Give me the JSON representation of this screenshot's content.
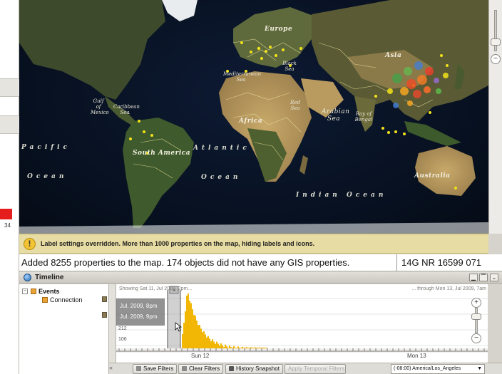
{
  "left_panel": {
    "badge_count": "34",
    "badge_color": "#e61d1d"
  },
  "map": {
    "labels": {
      "europe": "Europe",
      "asia": "Asia",
      "africa": "Africa",
      "south_america": "South America",
      "australia": "Australia",
      "pacific": "Pacific",
      "pacific_ocean": "Ocean",
      "atlantic": "Atlantic",
      "atlantic_ocean": "Ocean",
      "indian_ocean": "Indian Ocean",
      "black_sea": "Black Sea",
      "mediterranean_sea": "Mediterranean Sea",
      "red_sea": "Red Sea",
      "arabian_sea": "Arabian Sea",
      "bay_of_bengal": "Bay of Bengal",
      "gulf_of_mexico": "Gulf of Mexico",
      "caribbean_sea": "Caribbean Sea"
    },
    "zoom": {
      "plus": "+",
      "minus": "−"
    }
  },
  "warning": {
    "icon": "!",
    "text": "Label settings overridden. More than 1000 properties on the map, hiding labels and icons."
  },
  "status_bar": {
    "message": "Added 8255 properties to the map. 174 objects did not have any GIS properties.",
    "coordinates": "14G NR 16599 071"
  },
  "timeline": {
    "title": "Timeline",
    "tree": {
      "root": "Events",
      "child": "Connection"
    },
    "range_start": "Showing Sat 11, Jul 2009, 2pm...",
    "range_end": "... through Mon 13, Jul 2009, 7am",
    "tooltip": [
      "Jul. 2009, 8pm",
      "Jul. 2009, 9pm"
    ],
    "y_ticks": [
      "212",
      "106"
    ],
    "x_labels": [
      "Sun 12",
      "Mon 13"
    ],
    "histogram_color": "#f2b705",
    "buttons": {
      "save_filters": "Save Filters",
      "clear_filters": "Clear Filters",
      "history_snapshot": "History Snapshot",
      "apply_temporal": "Apply Temporal Filters"
    },
    "timezone": "(-08:00) America/Los_Angeles"
  }
}
